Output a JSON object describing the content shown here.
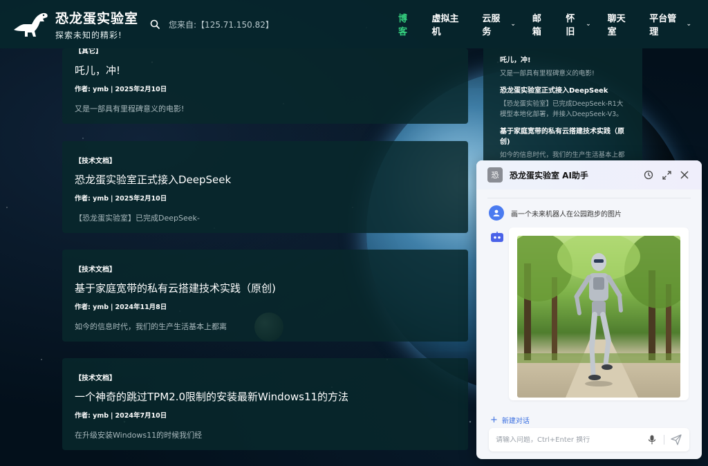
{
  "header": {
    "logo_title": "恐龙蛋实验室",
    "logo_subtitle": "探索未知的精彩!",
    "visitor_text": "您来自:【125.71.150.82】",
    "nav": [
      {
        "label": "博客",
        "active": true,
        "dropdown": false
      },
      {
        "label": "虚拟主机",
        "active": false,
        "dropdown": false
      },
      {
        "label": "云服务",
        "active": false,
        "dropdown": true
      },
      {
        "label": "邮箱",
        "active": false,
        "dropdown": false
      },
      {
        "label": "怀旧",
        "active": false,
        "dropdown": true
      },
      {
        "label": "聊天室",
        "active": false,
        "dropdown": false
      },
      {
        "label": "平台管理",
        "active": false,
        "dropdown": true
      }
    ]
  },
  "posts": [
    {
      "category": "【其它】",
      "title": "吒儿，冲!",
      "author_label": "作者:",
      "author": "ymb",
      "date": "2025年2月10日",
      "excerpt": "又是一部具有里程碑意义的电影!"
    },
    {
      "category": "【技术文档】",
      "title": "恐龙蛋实验室正式接入DeepSeek",
      "author_label": "作者:",
      "author": "ymb",
      "date": "2025年2月10日",
      "excerpt": "【恐龙蛋实验室】已完成DeepSeek-"
    },
    {
      "category": "【技术文档】",
      "title": "基于家庭宽带的私有云搭建技术实践（原创)",
      "author_label": "作者:",
      "author": "ymb",
      "date": "2024年11月8日",
      "excerpt": "如今的信息时代，我们的生产生活基本上都离"
    },
    {
      "category": "【技术文档】",
      "title": "一个神奇的跳过TPM2.0限制的安装最新Windows11的方法",
      "author_label": "作者:",
      "author": "ymb",
      "date": "2024年7月10日",
      "excerpt": "在升级安装Windows11的时候我们经"
    }
  ],
  "sidebar": {
    "items": [
      {
        "title": "吒儿，冲!",
        "desc": "又是一部具有里程碑意义的电影!"
      },
      {
        "title": "恐龙蛋实验室正式接入DeepSeek",
        "desc": "【恐龙蛋实验室】已完成DeepSeek-R1大模型本地化部署，并接入DeepSeek-V3。"
      },
      {
        "title": "基于家庭宽带的私有云搭建技术实践（原创)",
        "desc": "如今的信息时代，我们的生产生活基本上都"
      }
    ]
  },
  "ai_panel": {
    "avatar_char": "恐",
    "title": "恐龙蛋实验室 AI助手",
    "user_message": "画一个未来机器人在公园跑步的图片",
    "new_chat_label": "新建对话",
    "input_placeholder": "请输入问题，Ctrl+Enter 换行"
  },
  "colors": {
    "active_nav": "#35d07f",
    "header_bg": "#06262c",
    "card_bg": "#08282c",
    "accent_blue": "#3a6fe0"
  },
  "icons": [
    "dinosaur-logo-icon",
    "search-icon",
    "history-icon",
    "expand-icon",
    "close-icon",
    "user-icon",
    "bot-icon",
    "microphone-icon",
    "send-icon"
  ]
}
